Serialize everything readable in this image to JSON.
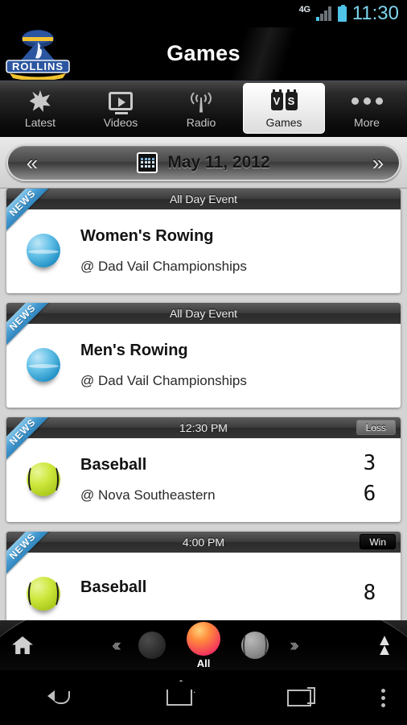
{
  "status_bar": {
    "network": "4G",
    "time": "11:30",
    "signal_icon": "signal-bars-icon",
    "battery_icon": "battery-full-icon",
    "accent_color": "#7fd4ee"
  },
  "header": {
    "title": "Games",
    "logo_text": "ROLLINS",
    "logo_icon": "rollins-tars-logo",
    "brand_color": "#1e3a68"
  },
  "tabs": [
    {
      "label": "Latest",
      "icon": "star-icon",
      "selected": false
    },
    {
      "label": "Videos",
      "icon": "video-icon",
      "selected": false
    },
    {
      "label": "Radio",
      "icon": "radio-tower-icon",
      "selected": false
    },
    {
      "label": "Games",
      "icon": "vs-icon",
      "selected": true
    },
    {
      "label": "More",
      "icon": "ellipsis-icon",
      "selected": false
    }
  ],
  "date_bar": {
    "prev_label": "«",
    "next_label": "»",
    "calendar_icon": "calendar-icon",
    "date": "May 11, 2012"
  },
  "games": [
    {
      "ribbon": "NEWS",
      "time": "All Day Event",
      "status": "",
      "sport": "Women's Rowing",
      "opponent": "@ Dad Vail Championships",
      "ball_icon": "rowing-ball-icon",
      "ball_color": "#66c2e8",
      "score_team": "",
      "score_opponent": ""
    },
    {
      "ribbon": "NEWS",
      "time": "All Day Event",
      "status": "",
      "sport": "Men's Rowing",
      "opponent": "@ Dad Vail Championships",
      "ball_icon": "rowing-ball-icon",
      "ball_color": "#66c2e8",
      "score_team": "",
      "score_opponent": ""
    },
    {
      "ribbon": "NEWS",
      "time": "12:30 PM",
      "status": "Loss",
      "sport": "Baseball",
      "opponent": "@ Nova Southeastern",
      "ball_icon": "baseball-icon",
      "ball_color": "#cfe83f",
      "score_team": "3",
      "score_opponent": "6"
    },
    {
      "ribbon": "NEWS",
      "time": "4:00 PM",
      "status": "Win",
      "sport": "Baseball",
      "opponent": "",
      "ball_icon": "baseball-icon",
      "ball_color": "#cfe83f",
      "score_team": "8",
      "score_opponent": ""
    }
  ],
  "sport_bar": {
    "home_icon": "home-icon",
    "prev_icon": "carousel-prev-chevron-icon",
    "next_icon": "carousel-next-chevron-icon",
    "selected_label": "All",
    "selected_color": "#ff8a3c",
    "expand_icon": "chevron-up-icon"
  },
  "android_nav": {
    "back_icon": "back-icon",
    "home_icon": "home-icon",
    "recents_icon": "recents-icon",
    "menu_icon": "overflow-menu-icon"
  }
}
